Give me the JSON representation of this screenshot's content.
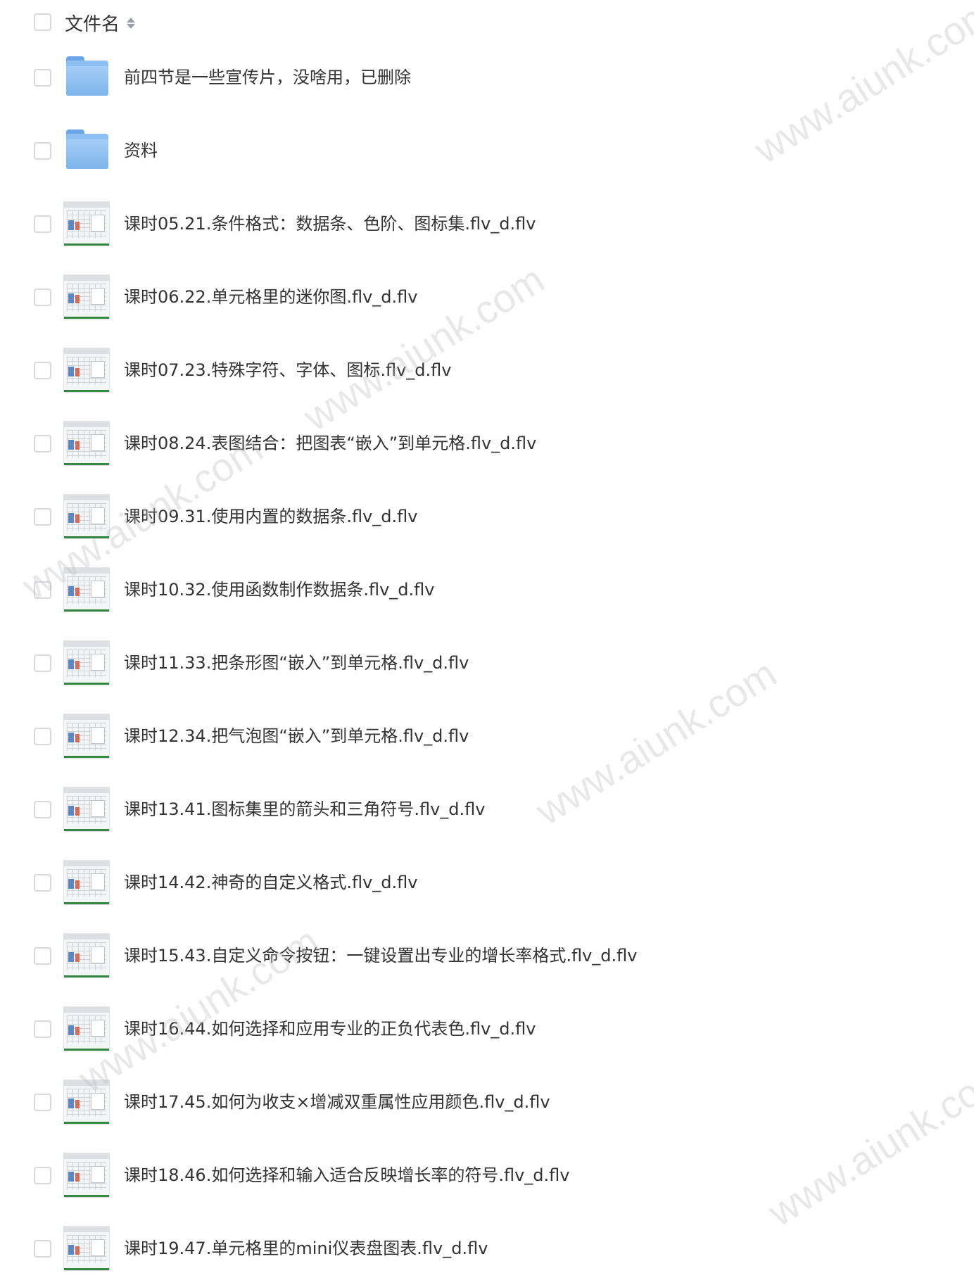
{
  "header": {
    "label": "文件名"
  },
  "files": [
    {
      "type": "folder",
      "icon": "folder-icon",
      "name": "前四节是一些宣传片，没啥用，已删除"
    },
    {
      "type": "folder",
      "icon": "folder-icon",
      "name": "资料"
    },
    {
      "type": "video",
      "icon": "video-thumbnail",
      "name": "课时05.21.条件格式：数据条、色阶、图标集.flv_d.flv"
    },
    {
      "type": "video",
      "icon": "video-thumbnail",
      "name": "课时06.22.单元格里的迷你图.flv_d.flv"
    },
    {
      "type": "video",
      "icon": "video-thumbnail",
      "name": "课时07.23.特殊字符、字体、图标.flv_d.flv"
    },
    {
      "type": "video",
      "icon": "video-thumbnail",
      "name": "课时08.24.表图结合：把图表“嵌入”到单元格.flv_d.flv"
    },
    {
      "type": "video",
      "icon": "video-thumbnail",
      "name": "课时09.31.使用内置的数据条.flv_d.flv"
    },
    {
      "type": "video",
      "icon": "video-thumbnail",
      "name": "课时10.32.使用函数制作数据条.flv_d.flv"
    },
    {
      "type": "video",
      "icon": "video-thumbnail",
      "name": "课时11.33.把条形图“嵌入”到单元格.flv_d.flv"
    },
    {
      "type": "video",
      "icon": "video-thumbnail",
      "name": "课时12.34.把气泡图“嵌入”到单元格.flv_d.flv"
    },
    {
      "type": "video",
      "icon": "video-thumbnail",
      "name": "课时13.41.图标集里的箭头和三角符号.flv_d.flv"
    },
    {
      "type": "video",
      "icon": "video-thumbnail",
      "name": "课时14.42.神奇的自定义格式.flv_d.flv"
    },
    {
      "type": "video",
      "icon": "video-thumbnail",
      "name": "课时15.43.自定义命令按钮：一键设置出专业的增长率格式.flv_d.flv"
    },
    {
      "type": "video",
      "icon": "video-thumbnail",
      "name": "课时16.44.如何选择和应用专业的正负代表色.flv_d.flv"
    },
    {
      "type": "video",
      "icon": "video-thumbnail",
      "name": "课时17.45.如何为收支×增减双重属性应用颜色.flv_d.flv"
    },
    {
      "type": "video",
      "icon": "video-thumbnail",
      "name": "课时18.46.如何选择和输入适合反映增长率的符号.flv_d.flv"
    },
    {
      "type": "video",
      "icon": "video-thumbnail",
      "name": "课时19.47.单元格里的mini仪表盘图表.flv_d.flv"
    }
  ],
  "watermark": {
    "text": "www.aiunk.com"
  }
}
